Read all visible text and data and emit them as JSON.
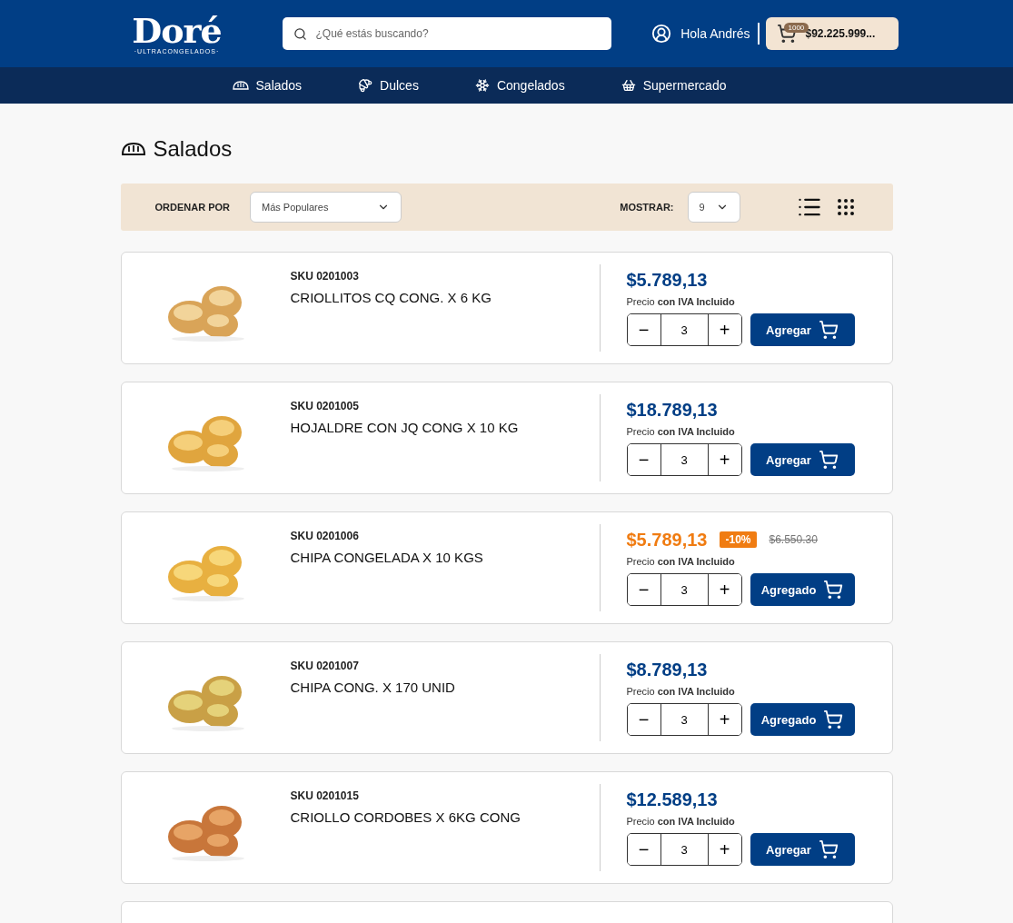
{
  "header": {
    "logo": "Doré",
    "logo_tagline": "·ULTRACONGELADOS·",
    "search": {
      "placeholder": "¿Qué estás buscando?"
    },
    "greeting": "Hola Andrés",
    "cart": {
      "count": "1000",
      "total": "$92.225.999..."
    }
  },
  "nav": [
    {
      "label": "Salados"
    },
    {
      "label": "Dulces"
    },
    {
      "label": "Congelados"
    },
    {
      "label": "Supermercado"
    }
  ],
  "page_title": "Salados",
  "toolbar": {
    "sort_label": "ORDENAR POR",
    "sort_value": "Más Populares",
    "show_label": "MOSTRAR:",
    "show_value": "9"
  },
  "products": [
    {
      "sku": "SKU 0201003",
      "name": "CRIOLLITOS CQ CONG. X 6 KG",
      "price": "$5.789,13",
      "on_sale": false,
      "vat_note": "Precio **con IVA Incluido**",
      "quantity": "3",
      "minus": "−",
      "plus": "+",
      "button": "Agregar",
      "kind": "picture"
    },
    {
      "sku": "SKU 0201005",
      "name": "HOJALDRE CON JQ CONG X 10 KG",
      "price": "$18.789,13",
      "on_sale": false,
      "vat_note": "Precio **con IVA Incluido**",
      "quantity": "3",
      "minus": "−",
      "plus": "+",
      "button": "Agregar",
      "kind": "picture"
    },
    {
      "sku": "SKU 0201006",
      "name": "CHIPA CONGELADA X 10 KGS",
      "price": "$5.789,13",
      "on_sale": true,
      "discount": "-10%",
      "old_price": "$6.550.30",
      "vat_note": "Precio **con IVA Incluido**",
      "quantity": "3",
      "minus": "−",
      "plus": "+",
      "button": "Agregado",
      "kind": "picture"
    },
    {
      "sku": "SKU 0201007",
      "name": "CHIPA CONG. X 170 UNID",
      "price": "$8.789,13",
      "on_sale": false,
      "vat_note": "Precio **con IVA Incluido**",
      "quantity": "3",
      "minus": "−",
      "plus": "+",
      "button": "Agregado",
      "kind": "picture"
    },
    {
      "sku": "SKU 0201015",
      "name": "CRIOLLO CORDOBES X 6KG CONG",
      "price": "$12.589,13",
      "on_sale": false,
      "vat_note": "Precio **con IVA Incluido**",
      "quantity": "3",
      "minus": "−",
      "plus": "+",
      "button": "Agregar",
      "kind": "picture"
    }
  ]
}
